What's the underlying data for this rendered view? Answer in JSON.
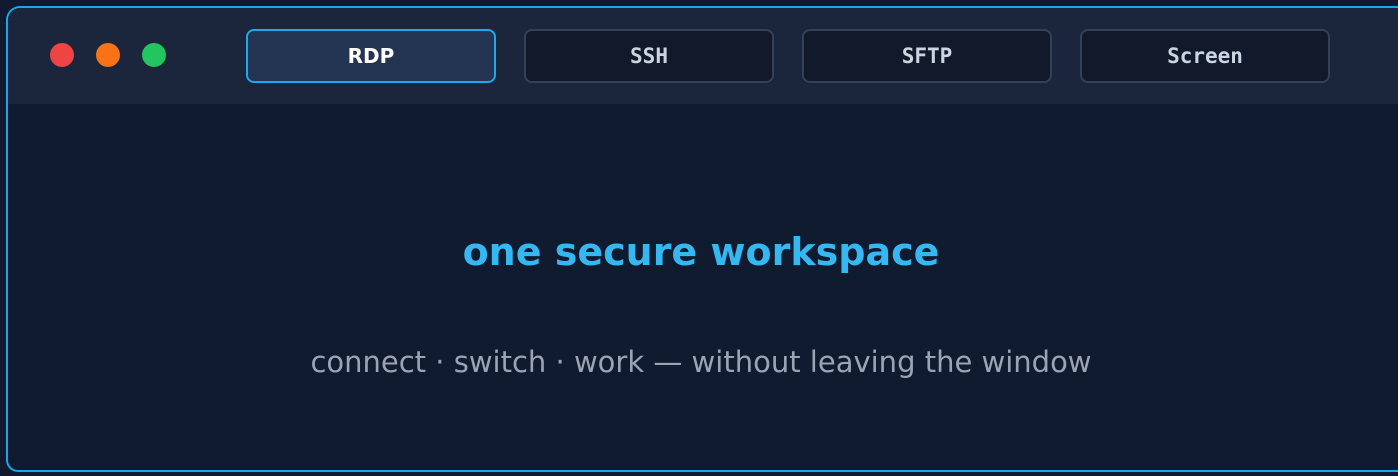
{
  "window": {
    "controls": [
      {
        "name": "close",
        "color": "#ef4444"
      },
      {
        "name": "minimize",
        "color": "#f97316"
      },
      {
        "name": "maximize",
        "color": "#22c55e"
      }
    ]
  },
  "tabs": [
    {
      "label": "RDP",
      "active": true
    },
    {
      "label": "SSH",
      "active": false
    },
    {
      "label": "SFTP",
      "active": false
    },
    {
      "label": "Screen",
      "active": false
    }
  ],
  "main": {
    "headline": "one secure workspace",
    "tagline": "connect · switch · work — without leaving the window"
  },
  "colors": {
    "accent": "#1fa8ea",
    "headline": "#35b7f2"
  }
}
